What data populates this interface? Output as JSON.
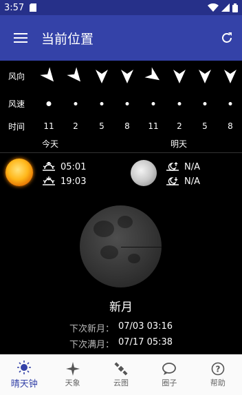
{
  "status_bar": {
    "time": "3:57"
  },
  "app_bar": {
    "title": "当前位置"
  },
  "forecast": {
    "wind_dir_label": "风向",
    "wind_speed_label": "风速",
    "time_label": "时间",
    "wind_directions": [
      "northeast",
      "northeast",
      "south",
      "south",
      "northeast",
      "south",
      "south",
      "south"
    ],
    "times": [
      "11",
      "2",
      "5",
      "8",
      "11",
      "2",
      "5",
      "8"
    ],
    "today_label": "今天",
    "tomorrow_label": "明天"
  },
  "sun": {
    "rise": "05:01",
    "set": "19:03"
  },
  "moon": {
    "rise": "N/A",
    "set": "N/A"
  },
  "phase": {
    "name": "新月",
    "next_new_label": "下次新月：",
    "next_new_value": "07/03 03:16",
    "next_full_label": "下次满月：",
    "next_full_value": "07/17 05:38"
  },
  "nav": {
    "items": [
      {
        "label": "晴天钟",
        "icon": "sun-icon",
        "active": true
      },
      {
        "label": "天象",
        "icon": "star-icon",
        "active": false
      },
      {
        "label": "云图",
        "icon": "satellite-icon",
        "active": false
      },
      {
        "label": "圈子",
        "icon": "chat-icon",
        "active": false
      },
      {
        "label": "帮助",
        "icon": "help-icon",
        "active": false
      }
    ]
  },
  "colors": {
    "primary": "#3442a8",
    "status": "#263089"
  }
}
